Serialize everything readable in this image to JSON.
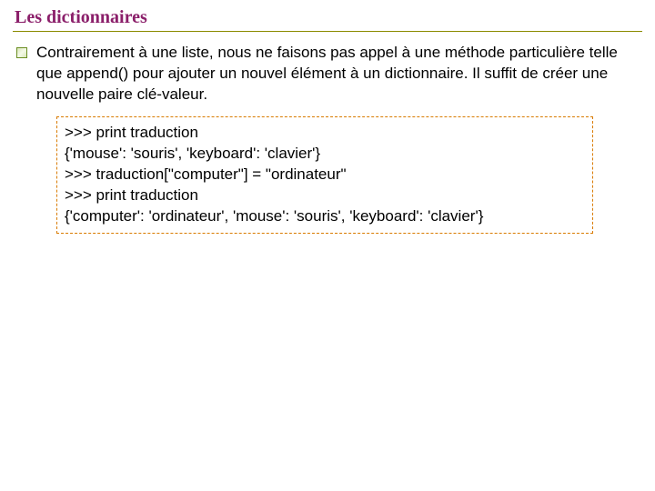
{
  "title": "Les dictionnaires",
  "bullet": "Contrairement à une liste, nous ne faisons pas appel à une méthode particulière telle que append() pour ajouter un nouvel élément à un dictionnaire. Il suffit de créer une nouvelle paire clé-valeur.",
  "code_lines": [
    ">>> print traduction",
    "{'mouse': 'souris', 'keyboard': 'clavier'}",
    ">>> traduction[\"computer\"] = \"ordinateur\"",
    ">>> print traduction",
    "{'computer': 'ordinateur', 'mouse': 'souris', 'keyboard': 'clavier'}"
  ]
}
